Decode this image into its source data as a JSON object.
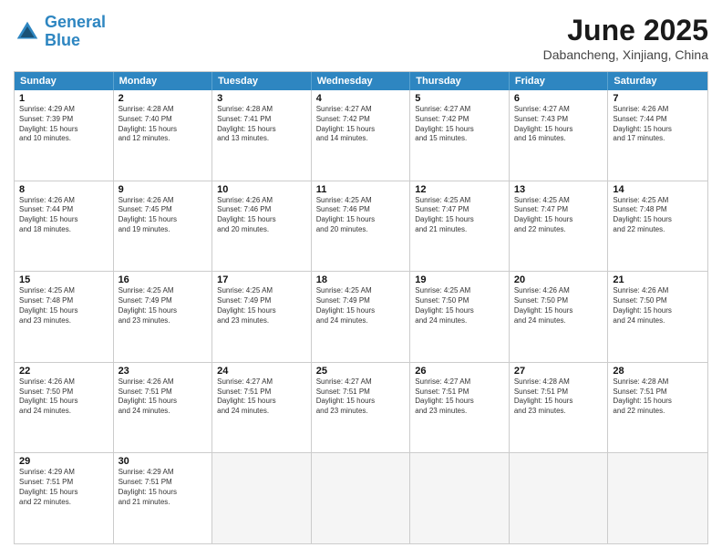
{
  "logo": {
    "line1": "General",
    "line2": "Blue"
  },
  "title": "June 2025",
  "location": "Dabancheng, Xinjiang, China",
  "header_days": [
    "Sunday",
    "Monday",
    "Tuesday",
    "Wednesday",
    "Thursday",
    "Friday",
    "Saturday"
  ],
  "rows": [
    [
      {
        "day": "1",
        "lines": [
          "Sunrise: 4:29 AM",
          "Sunset: 7:39 PM",
          "Daylight: 15 hours",
          "and 10 minutes."
        ]
      },
      {
        "day": "2",
        "lines": [
          "Sunrise: 4:28 AM",
          "Sunset: 7:40 PM",
          "Daylight: 15 hours",
          "and 12 minutes."
        ]
      },
      {
        "day": "3",
        "lines": [
          "Sunrise: 4:28 AM",
          "Sunset: 7:41 PM",
          "Daylight: 15 hours",
          "and 13 minutes."
        ]
      },
      {
        "day": "4",
        "lines": [
          "Sunrise: 4:27 AM",
          "Sunset: 7:42 PM",
          "Daylight: 15 hours",
          "and 14 minutes."
        ]
      },
      {
        "day": "5",
        "lines": [
          "Sunrise: 4:27 AM",
          "Sunset: 7:42 PM",
          "Daylight: 15 hours",
          "and 15 minutes."
        ]
      },
      {
        "day": "6",
        "lines": [
          "Sunrise: 4:27 AM",
          "Sunset: 7:43 PM",
          "Daylight: 15 hours",
          "and 16 minutes."
        ]
      },
      {
        "day": "7",
        "lines": [
          "Sunrise: 4:26 AM",
          "Sunset: 7:44 PM",
          "Daylight: 15 hours",
          "and 17 minutes."
        ]
      }
    ],
    [
      {
        "day": "8",
        "lines": [
          "Sunrise: 4:26 AM",
          "Sunset: 7:44 PM",
          "Daylight: 15 hours",
          "and 18 minutes."
        ]
      },
      {
        "day": "9",
        "lines": [
          "Sunrise: 4:26 AM",
          "Sunset: 7:45 PM",
          "Daylight: 15 hours",
          "and 19 minutes."
        ]
      },
      {
        "day": "10",
        "lines": [
          "Sunrise: 4:26 AM",
          "Sunset: 7:46 PM",
          "Daylight: 15 hours",
          "and 20 minutes."
        ]
      },
      {
        "day": "11",
        "lines": [
          "Sunrise: 4:25 AM",
          "Sunset: 7:46 PM",
          "Daylight: 15 hours",
          "and 20 minutes."
        ]
      },
      {
        "day": "12",
        "lines": [
          "Sunrise: 4:25 AM",
          "Sunset: 7:47 PM",
          "Daylight: 15 hours",
          "and 21 minutes."
        ]
      },
      {
        "day": "13",
        "lines": [
          "Sunrise: 4:25 AM",
          "Sunset: 7:47 PM",
          "Daylight: 15 hours",
          "and 22 minutes."
        ]
      },
      {
        "day": "14",
        "lines": [
          "Sunrise: 4:25 AM",
          "Sunset: 7:48 PM",
          "Daylight: 15 hours",
          "and 22 minutes."
        ]
      }
    ],
    [
      {
        "day": "15",
        "lines": [
          "Sunrise: 4:25 AM",
          "Sunset: 7:48 PM",
          "Daylight: 15 hours",
          "and 23 minutes."
        ]
      },
      {
        "day": "16",
        "lines": [
          "Sunrise: 4:25 AM",
          "Sunset: 7:49 PM",
          "Daylight: 15 hours",
          "and 23 minutes."
        ]
      },
      {
        "day": "17",
        "lines": [
          "Sunrise: 4:25 AM",
          "Sunset: 7:49 PM",
          "Daylight: 15 hours",
          "and 23 minutes."
        ]
      },
      {
        "day": "18",
        "lines": [
          "Sunrise: 4:25 AM",
          "Sunset: 7:49 PM",
          "Daylight: 15 hours",
          "and 24 minutes."
        ]
      },
      {
        "day": "19",
        "lines": [
          "Sunrise: 4:25 AM",
          "Sunset: 7:50 PM",
          "Daylight: 15 hours",
          "and 24 minutes."
        ]
      },
      {
        "day": "20",
        "lines": [
          "Sunrise: 4:26 AM",
          "Sunset: 7:50 PM",
          "Daylight: 15 hours",
          "and 24 minutes."
        ]
      },
      {
        "day": "21",
        "lines": [
          "Sunrise: 4:26 AM",
          "Sunset: 7:50 PM",
          "Daylight: 15 hours",
          "and 24 minutes."
        ]
      }
    ],
    [
      {
        "day": "22",
        "lines": [
          "Sunrise: 4:26 AM",
          "Sunset: 7:50 PM",
          "Daylight: 15 hours",
          "and 24 minutes."
        ]
      },
      {
        "day": "23",
        "lines": [
          "Sunrise: 4:26 AM",
          "Sunset: 7:51 PM",
          "Daylight: 15 hours",
          "and 24 minutes."
        ]
      },
      {
        "day": "24",
        "lines": [
          "Sunrise: 4:27 AM",
          "Sunset: 7:51 PM",
          "Daylight: 15 hours",
          "and 24 minutes."
        ]
      },
      {
        "day": "25",
        "lines": [
          "Sunrise: 4:27 AM",
          "Sunset: 7:51 PM",
          "Daylight: 15 hours",
          "and 23 minutes."
        ]
      },
      {
        "day": "26",
        "lines": [
          "Sunrise: 4:27 AM",
          "Sunset: 7:51 PM",
          "Daylight: 15 hours",
          "and 23 minutes."
        ]
      },
      {
        "day": "27",
        "lines": [
          "Sunrise: 4:28 AM",
          "Sunset: 7:51 PM",
          "Daylight: 15 hours",
          "and 23 minutes."
        ]
      },
      {
        "day": "28",
        "lines": [
          "Sunrise: 4:28 AM",
          "Sunset: 7:51 PM",
          "Daylight: 15 hours",
          "and 22 minutes."
        ]
      }
    ],
    [
      {
        "day": "29",
        "lines": [
          "Sunrise: 4:29 AM",
          "Sunset: 7:51 PM",
          "Daylight: 15 hours",
          "and 22 minutes."
        ]
      },
      {
        "day": "30",
        "lines": [
          "Sunrise: 4:29 AM",
          "Sunset: 7:51 PM",
          "Daylight: 15 hours",
          "and 21 minutes."
        ]
      },
      {
        "day": "",
        "lines": []
      },
      {
        "day": "",
        "lines": []
      },
      {
        "day": "",
        "lines": []
      },
      {
        "day": "",
        "lines": []
      },
      {
        "day": "",
        "lines": []
      }
    ]
  ]
}
